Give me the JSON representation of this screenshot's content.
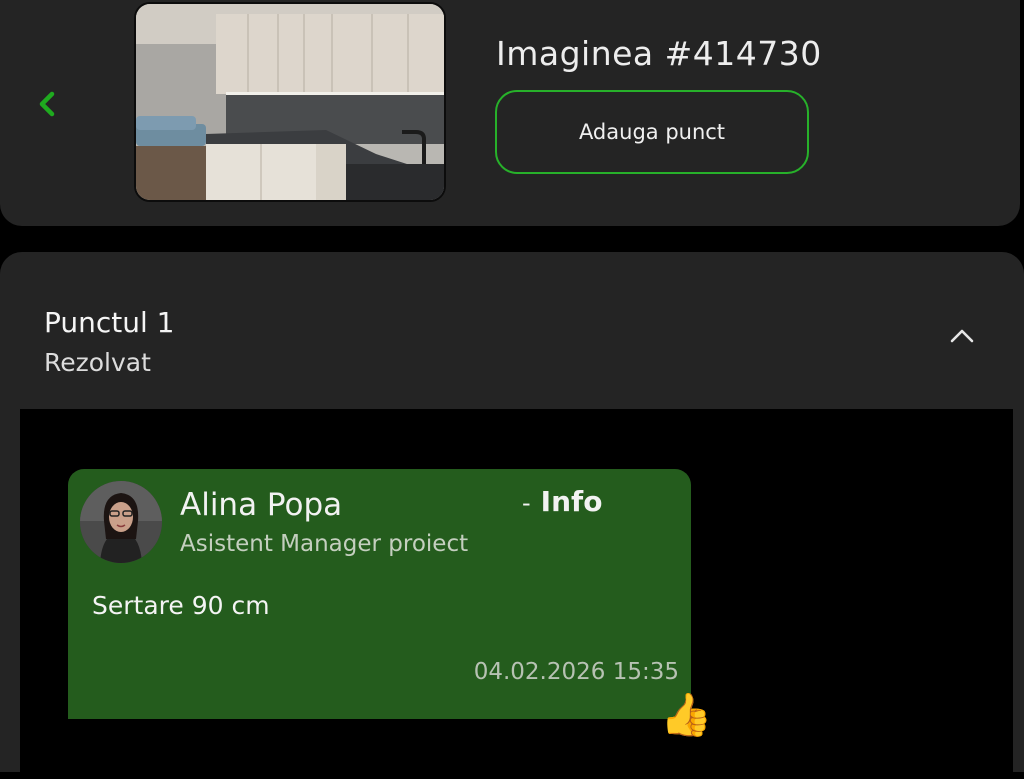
{
  "header": {
    "image_title": "Imaginea #414730",
    "add_button_label": "Adauga punct",
    "back_icon": "chevron-left-icon",
    "thumbnail_icon": "kitchen-photo"
  },
  "point": {
    "title": "Punctul 1",
    "status": "Rezolvat",
    "toggle_icon": "chevron-up-icon"
  },
  "message": {
    "author": "Alina Popa",
    "role": "Asistent Manager proiect",
    "tag_separator": "-",
    "tag": "Info",
    "text": "Sertare 90 cm",
    "timestamp": "04.02.2026 15:35",
    "reaction": "👍"
  },
  "colors": {
    "accent_green": "#27b12a",
    "bubble_green": "#245c1d",
    "card_bg": "#242424",
    "page_bg": "#000000"
  }
}
